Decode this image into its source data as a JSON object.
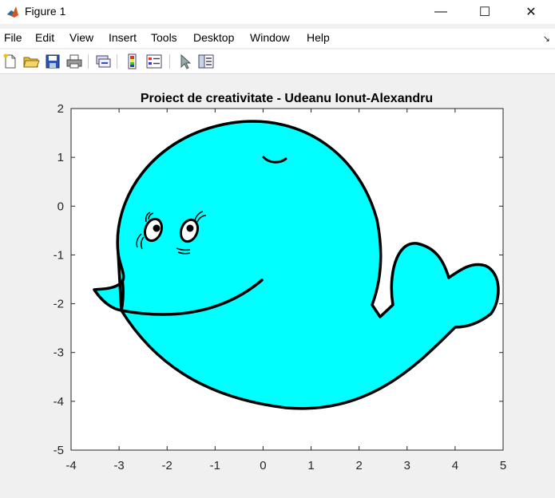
{
  "window": {
    "title": "Figure 1",
    "controls": {
      "minimize": "—",
      "maximize": "☐",
      "close": "✕"
    }
  },
  "menu": {
    "items": [
      "File",
      "Edit",
      "View",
      "Insert",
      "Tools",
      "Desktop",
      "Window",
      "Help"
    ],
    "extra_icon": "dock-arrow-icon"
  },
  "toolbar": {
    "buttons": [
      "new-figure-icon",
      "open-file-icon",
      "save-icon",
      "print-icon",
      "link-plot-icon",
      "insert-colorbar-icon",
      "insert-legend-icon",
      "edit-plot-icon",
      "property-inspector-icon"
    ]
  },
  "axes": {
    "title": "Proiect de creativitate - Udeanu Ionut-Alexandru",
    "xlim": [
      -4,
      5
    ],
    "ylim": [
      -5,
      2
    ],
    "xticks": [
      "-4",
      "-3",
      "-2",
      "-1",
      "0",
      "1",
      "2",
      "3",
      "4",
      "5"
    ],
    "yticks": [
      "2",
      "1",
      "0",
      "-1",
      "-2",
      "-3",
      "-4",
      "-5"
    ],
    "background": "#ffffff"
  },
  "colors": {
    "whale_fill": "#00ffff",
    "outline": "#000000",
    "figure_bg": "#f0f0f0"
  }
}
